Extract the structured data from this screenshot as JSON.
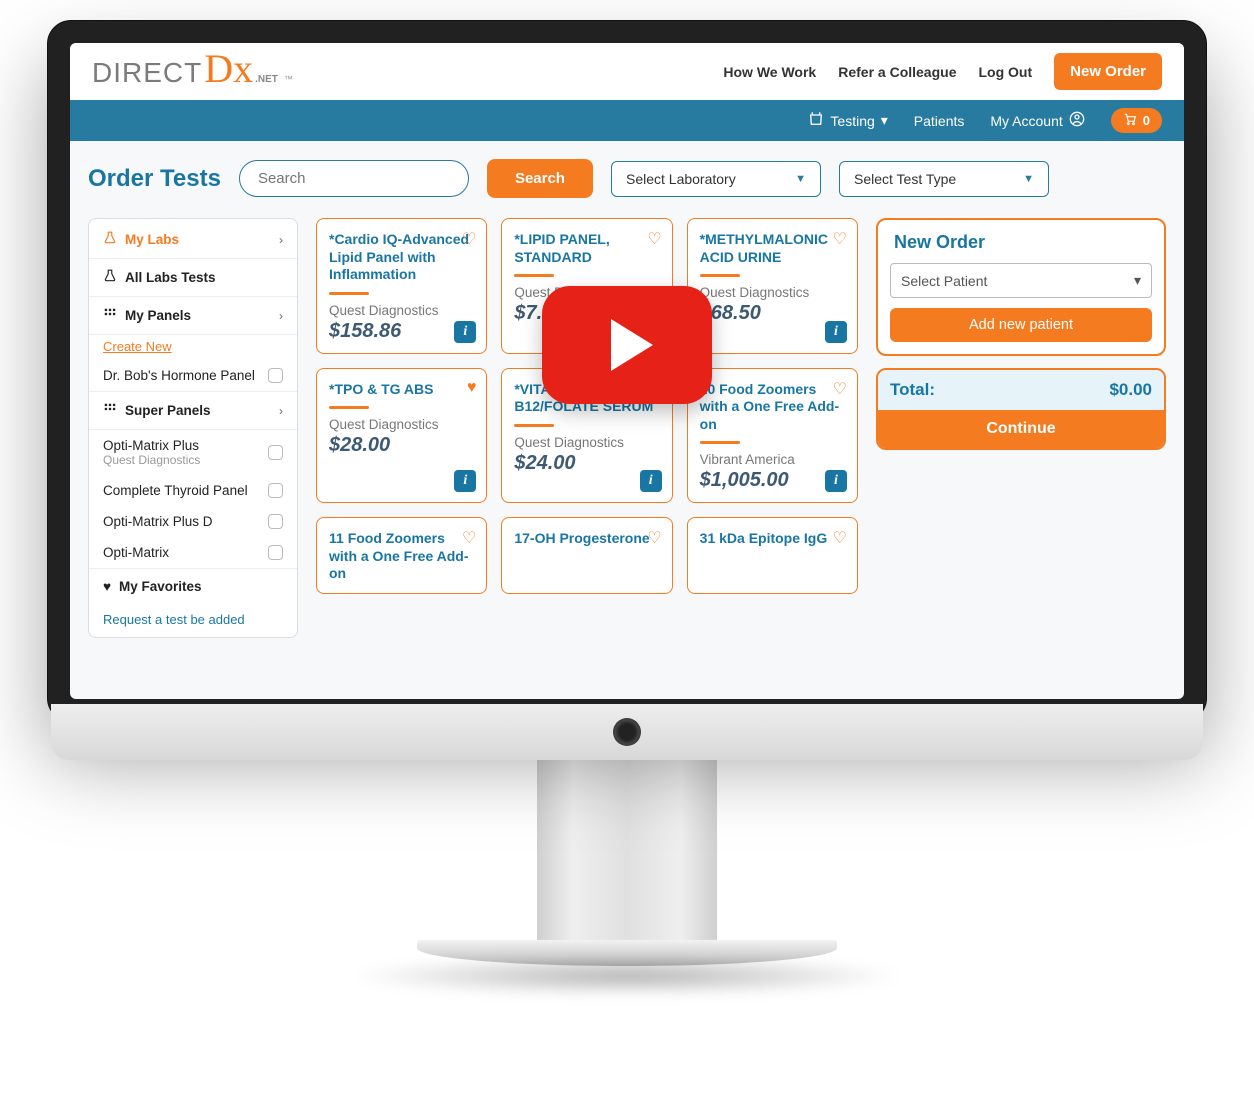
{
  "brand": {
    "direct": "DIRECT",
    "dx": "Dx",
    "net": ".NET",
    "tm": "™"
  },
  "topnav": {
    "how": "How We Work",
    "refer": "Refer a Colleague",
    "logout": "Log Out",
    "neworder": "New Order"
  },
  "nav2": {
    "testing": "Testing",
    "patients": "Patients",
    "account": "My Account",
    "cart_count": "0"
  },
  "page": {
    "title": "Order Tests"
  },
  "search": {
    "placeholder": "Search",
    "button": "Search",
    "lab_placeholder": "Select Laboratory",
    "type_placeholder": "Select Test Type"
  },
  "sidebar": {
    "mylabs": "My Labs",
    "alllabs": "All Labs Tests",
    "mypanels": "My Panels",
    "create": "Create New",
    "panel1": "Dr. Bob's Hormone Panel",
    "superpanels": "Super Panels",
    "sp1": "Opti-Matrix Plus",
    "sp1_vendor": "Quest Diagnostics",
    "sp2": "Complete Thyroid Panel",
    "sp3": "Opti-Matrix Plus D",
    "sp4": "Opti-Matrix",
    "favorites": "My Favorites",
    "request": "Request a test be added"
  },
  "tests": [
    {
      "title": "*Cardio IQ-Advanced Lipid Panel with Inflammation",
      "vendor": "Quest Diagnostics",
      "price": "$158.86",
      "fav": false
    },
    {
      "title": "*LIPID PANEL, STANDARD",
      "vendor": "Quest Diagnostics",
      "price": "$7.00",
      "fav": false
    },
    {
      "title": "*METHYLMALONIC ACID URINE",
      "vendor": "Quest Diagnostics",
      "price": "$68.50",
      "fav": false
    },
    {
      "title": "*TPO & TG ABS",
      "vendor": "Quest Diagnostics",
      "price": "$28.00",
      "fav": true
    },
    {
      "title": "*VITAMIN B12/FOLATE SERUM",
      "vendor": "Quest Diagnostics",
      "price": "$24.00",
      "fav": false
    },
    {
      "title": "10 Food Zoomers with a One Free Add-on",
      "vendor": "Vibrant America",
      "price": "$1,005.00",
      "fav": false
    },
    {
      "title": "11 Food Zoomers with a One Free Add-on",
      "vendor": "",
      "price": "",
      "fav": false
    },
    {
      "title": "17-OH Progesterone",
      "vendor": "",
      "price": "",
      "fav": false
    },
    {
      "title": "31 kDa Epitope IgG",
      "vendor": "",
      "price": "",
      "fav": false
    }
  ],
  "order": {
    "title": "New Order",
    "select_patient": "Select Patient",
    "add_patient": "Add new patient",
    "total_label": "Total:",
    "total_value": "$0.00",
    "continue": "Continue"
  }
}
